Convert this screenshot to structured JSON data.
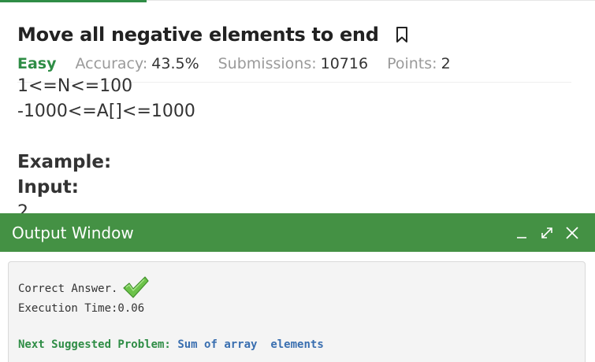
{
  "problem": {
    "title": "Move all negative elements to end",
    "difficulty": "Easy",
    "accuracy_label": "Accuracy:",
    "accuracy_value": "43.5%",
    "submissions_label": "Submissions:",
    "submissions_value": "10716",
    "points_label": "Points:",
    "points_value": "2"
  },
  "body": {
    "constraint_1": "1<=N<=100",
    "constraint_2": "-1000<=A[]<=1000",
    "example_heading": "Example:",
    "input_heading": "Input:",
    "input_first_value": "2"
  },
  "output_window": {
    "title": "Output Window",
    "result": "Correct Answer.",
    "execution_time": "Execution Time:0.06",
    "next_label": "Next Suggested Problem:",
    "next_problem": "Sum of array  elements"
  },
  "colors": {
    "brand_green": "#2f8d46",
    "output_bar": "#449144",
    "link_blue": "#3a6fb0"
  },
  "icons": [
    "bookmark-icon",
    "minimize-icon",
    "expand-icon",
    "close-icon",
    "check-icon"
  ]
}
